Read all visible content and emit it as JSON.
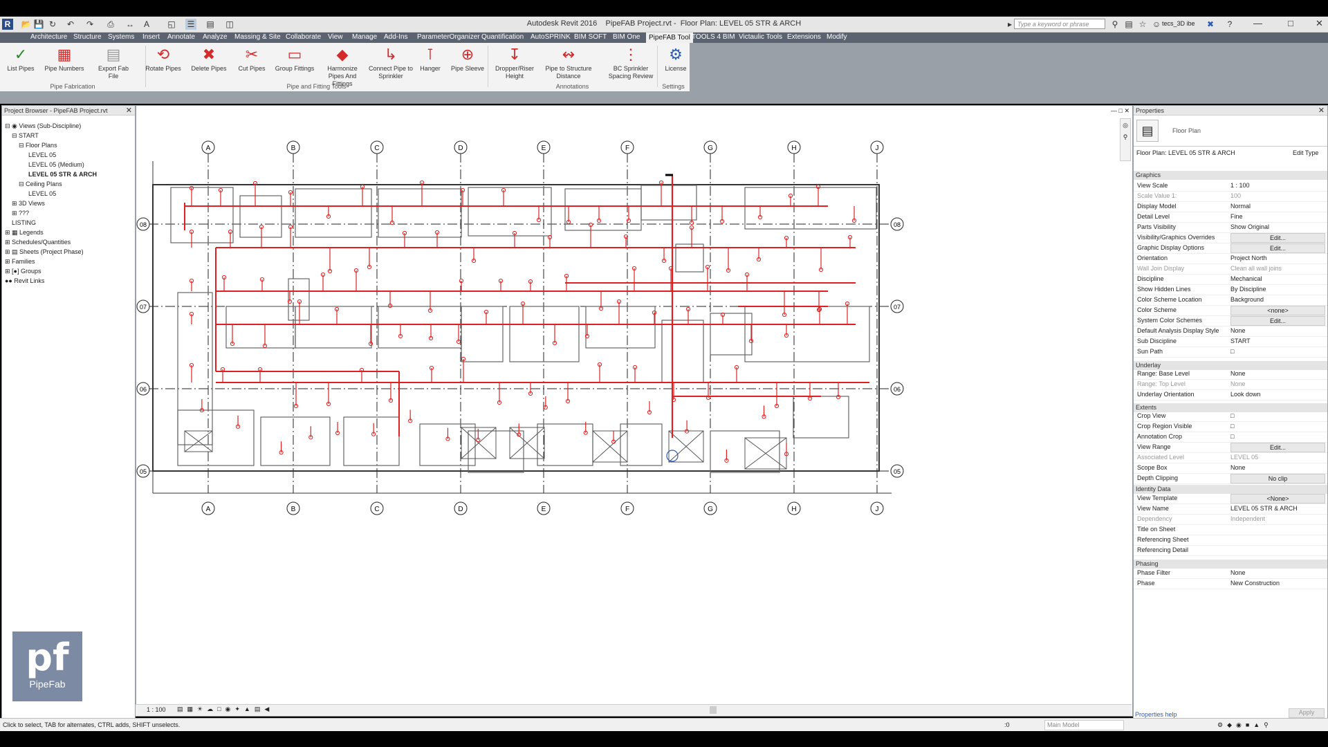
{
  "app": {
    "title": "Autodesk Revit 2016",
    "file": "PipeFAB Project.rvt",
    "view": "Floor Plan: LEVEL 05 STR & ARCH",
    "search_placeholder": "Type a keyword or phrase",
    "user": "tecs_3D ibe",
    "quick_access": [
      "R",
      "open-icon",
      "save-icon",
      "sync-icon",
      "undo-icon",
      "redo-icon",
      "print-icon",
      "measure-icon",
      "text-A-icon",
      "3d-icon",
      "section-icon",
      "thin-lines-icon",
      "close-hidden-icon",
      "switch-windows-icon"
    ]
  },
  "menu": {
    "tabs": [
      "Architecture",
      "Structure",
      "Systems",
      "Insert",
      "Annotate",
      "Analyze",
      "Massing & Site",
      "Collaborate",
      "View",
      "Manage",
      "Add-Ins",
      "ParameterOrganizer",
      "Quantification",
      "AutoSPRINK",
      "BIM SOFT",
      "BIM One",
      "PipeFAB Tool",
      "TOOLS 4 BIM",
      "Victaulic Tools",
      "Extensions",
      "Modify"
    ],
    "active": "PipeFAB Tool"
  },
  "ribbon": {
    "buttons": [
      {
        "label": "List Pipes",
        "icon": "list-pipes-icon"
      },
      {
        "label": "Pipe Numbers",
        "icon": "pipe-numbers-icon"
      },
      {
        "label": "Export Fab File",
        "icon": "export-icon"
      },
      {
        "label": "Rotate Pipes",
        "icon": "rotate-pipes-icon"
      },
      {
        "label": "Delete Pipes",
        "icon": "delete-pipes-icon"
      },
      {
        "label": "Cut Pipes",
        "icon": "cut-pipes-icon"
      },
      {
        "label": "Group Fittings",
        "icon": "group-fittings-icon"
      },
      {
        "label": "Harmonize Pipes And Fittings",
        "icon": "harmonize-icon"
      },
      {
        "label": "Connect Pipe to Sprinkler",
        "icon": "connect-pipe-icon"
      },
      {
        "label": "Hanger",
        "icon": "hanger-icon"
      },
      {
        "label": "Pipe Sleeve",
        "icon": "pipe-sleeve-icon"
      },
      {
        "label": "Dropper/Riser Height",
        "icon": "dropper-icon"
      },
      {
        "label": "Pipe to Structure Distance",
        "icon": "pipe-structure-icon"
      },
      {
        "label": "BC Sprinkler Spacing Review",
        "icon": "spacing-review-icon"
      },
      {
        "label": "License",
        "icon": "license-gear-icon"
      }
    ],
    "panels": [
      "Pipe Fabrication",
      "Pipe and Fitting Tools",
      "Annotations",
      "Settings"
    ]
  },
  "browser": {
    "title": "Project Browser - PipeFAB Project.rvt",
    "items": [
      "Views (Sub-Discipline)",
      "START",
      "Floor Plans",
      "LEVEL 05",
      "LEVEL 05 (Medium)",
      "LEVEL 05 STR & ARCH",
      "Ceiling Plans",
      "LEVEL 05",
      "3D Views",
      "???",
      "LISTING",
      "Legends",
      "Schedules/Quantities",
      "Sheets (Project Phase)",
      "Families",
      "Groups",
      "Revit Links"
    ]
  },
  "logo": {
    "mark": "pf",
    "text": "PipeFab"
  },
  "grid": {
    "columns": [
      "A",
      "B",
      "C",
      "D",
      "E",
      "F",
      "G",
      "H",
      "J"
    ],
    "rows": [
      "08",
      "07",
      "06",
      "05"
    ]
  },
  "properties": {
    "title": "Properties",
    "type": "Floor Plan",
    "selector": "Floor Plan: LEVEL 05 STR & ARCH",
    "edit_type": "Edit Type",
    "sections": {
      "graphics": "Graphics",
      "underlay": "Underlay",
      "extents": "Extents",
      "identity": "Identity Data",
      "phasing": "Phasing"
    },
    "rows": [
      {
        "k": "View Scale",
        "v": "1 : 100"
      },
      {
        "k": "Scale Value    1:",
        "v": "100"
      },
      {
        "k": "Display Model",
        "v": "Normal"
      },
      {
        "k": "Detail Level",
        "v": "Fine"
      },
      {
        "k": "Parts Visibility",
        "v": "Show Original"
      },
      {
        "k": "Visibility/Graphics Overrides",
        "v": "Edit..."
      },
      {
        "k": "Graphic Display Options",
        "v": "Edit..."
      },
      {
        "k": "Orientation",
        "v": "Project North"
      },
      {
        "k": "Wall Join Display",
        "v": "Clean all wall joins"
      },
      {
        "k": "Discipline",
        "v": "Mechanical"
      },
      {
        "k": "Show Hidden Lines",
        "v": "By Discipline"
      },
      {
        "k": "Color Scheme Location",
        "v": "Background"
      },
      {
        "k": "Color Scheme",
        "v": "<none>"
      },
      {
        "k": "System Color Schemes",
        "v": "Edit..."
      },
      {
        "k": "Default Analysis Display Style",
        "v": "None"
      },
      {
        "k": "Sub Discipline",
        "v": "START"
      },
      {
        "k": "Sun Path",
        "v": ""
      },
      {
        "k": "Range: Base Level",
        "v": "None"
      },
      {
        "k": "Range: Top Level",
        "v": "None"
      },
      {
        "k": "Underlay Orientation",
        "v": "Look down"
      },
      {
        "k": "Crop View",
        "v": ""
      },
      {
        "k": "Crop Region Visible",
        "v": ""
      },
      {
        "k": "Annotation Crop",
        "v": ""
      },
      {
        "k": "View Range",
        "v": "Edit..."
      },
      {
        "k": "Associated Level",
        "v": "LEVEL 05"
      },
      {
        "k": "Scope Box",
        "v": "None"
      },
      {
        "k": "Depth Clipping",
        "v": "No clip"
      },
      {
        "k": "View Template",
        "v": "<None>"
      },
      {
        "k": "View Name",
        "v": "LEVEL 05 STR & ARCH"
      },
      {
        "k": "Dependency",
        "v": "Independent"
      },
      {
        "k": "Title on Sheet",
        "v": ""
      },
      {
        "k": "Referencing Sheet",
        "v": ""
      },
      {
        "k": "Referencing Detail",
        "v": ""
      },
      {
        "k": "Phase Filter",
        "v": "None"
      },
      {
        "k": "Phase",
        "v": "New Construction"
      }
    ],
    "help": "Properties help",
    "apply": "Apply"
  },
  "viewbar": {
    "scale": "1 : 100"
  },
  "status": {
    "hint": "Click to select, TAB for alternates, CTRL adds, SHIFT unselects.",
    "coord": ":0",
    "model": "Main Model"
  },
  "colors": {
    "pipe": "#e02020",
    "wall": "#333333",
    "grid": "#222222",
    "accent_tab": "#5b6270"
  }
}
